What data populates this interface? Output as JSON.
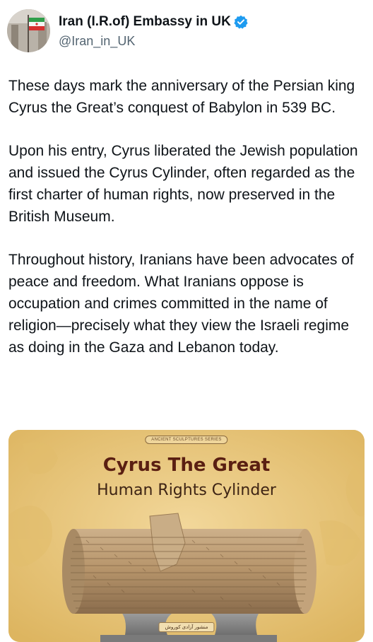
{
  "account": {
    "display_name": "Iran (I.R.of) Embassy in UK",
    "handle": "@Iran_in_UK",
    "verified_icon": "verified-badge-icon",
    "verified_color": "#1d9bf0"
  },
  "tweet": {
    "paragraphs": [
      "These days mark the anniversary of the Persian king Cyrus the Great’s conquest of Babylon in 539 BC.",
      "Upon his entry, Cyrus liberated the Jewish population and issued the Cyrus Cylinder, often regarded as the first charter of human rights, now preserved in the British Museum.",
      "Throughout history, Iranians have been advocates of peace and freedom. What Iranians oppose is occupation and crimes committed in the name of religion—precisely what they view the Israeli regime as doing in the Gaza and Lebanon today."
    ]
  },
  "media": {
    "series_label": "ANCIENT SCULPTURES SERIES",
    "title": "Cyrus The Great",
    "subtitle": "Human Rights Cylinder",
    "caption": "منشور آزادی کوروش",
    "background_color": "#e8c77a",
    "title_color": "#5a1f12"
  }
}
